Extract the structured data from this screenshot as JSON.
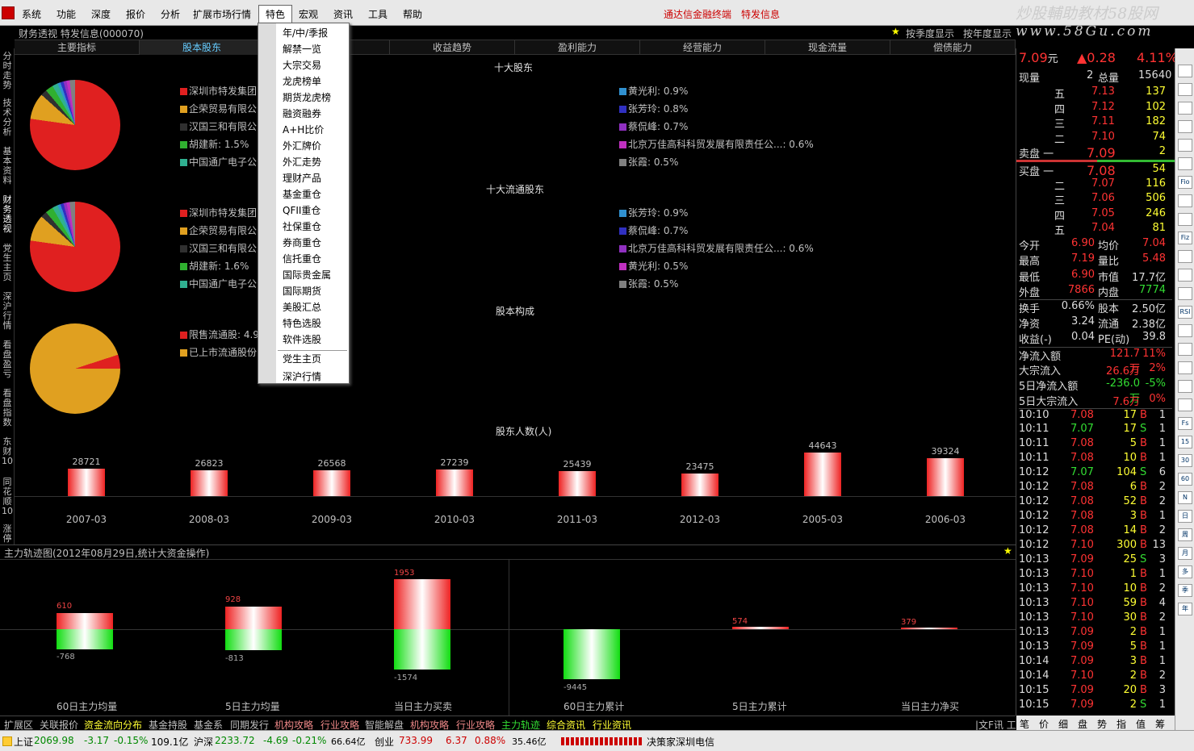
{
  "menu": {
    "items": [
      "系统",
      "功能",
      "深度",
      "报价",
      "分析",
      "扩展市场行情",
      "特色",
      "宏观",
      "资讯",
      "工具",
      "帮助"
    ],
    "right_links": [
      "通达信金融终端",
      "特发信息"
    ]
  },
  "watermark": {
    "line1": "炒股輔助教材58股网",
    "line2": "www.58Gu.com"
  },
  "header": {
    "title": "财务透视 特发信息(000070)",
    "right1": "按季度显示",
    "right2": "按年度显示"
  },
  "tabs": [
    "主要指标",
    "股本股东",
    "",
    "收益趋势",
    "盈利能力",
    "经营能力",
    "现金流量",
    "偿债能力"
  ],
  "left_tabs": [
    "分时走势",
    "技术分析",
    "基本资料",
    "财务透视",
    "党生主页",
    "深沪行情",
    "看盘盈亏",
    "看盘指数",
    "东财10",
    "同花顺10",
    "涨停"
  ],
  "sections": {
    "top10": "十大股东",
    "top10_float": "十大流通股东",
    "structure": "股本构成",
    "holders": "股东人数(人)"
  },
  "top10_left": [
    "深圳市特发集团",
    "企荣贸易有限公",
    "汉国三和有限公",
    "胡建新: 1.5%",
    "中国通广电子公"
  ],
  "top10_right": [
    "黄光利: 0.9%",
    "张芳玲: 0.8%",
    "蔡侃峰: 0.7%",
    "北京万佳高科科贸发展有限责任公...: 0.6%",
    "张霞: 0.5%"
  ],
  "float_left": [
    "深圳市特发集团",
    "企荣贸易有限公",
    "汉国三和有限公",
    "胡建新: 1.6%",
    "中国通广电子公"
  ],
  "float_right": [
    "张芳玲: 0.9%",
    "蔡侃峰: 0.7%",
    "北京万佳高科科贸发展有限责任公...: 0.6%",
    "黄光利: 0.5%",
    "张霞: 0.5%"
  ],
  "structure_legend": [
    "限售流通股: 4.9",
    "已上市流通股份"
  ],
  "colors": {
    "c1": "#e02020",
    "c2": "#e0a020",
    "c3": "#303030",
    "c4": "#30b030",
    "c5": "#30b090",
    "c6": "#3090d0",
    "c7": "#3030c0",
    "c8": "#9030c0",
    "c9": "#c030c0",
    "c10": "#808080"
  },
  "chart_data": {
    "type": "bar",
    "categories": [
      "2007-03",
      "2008-03",
      "2009-03",
      "2010-03",
      "2011-03",
      "2012-03",
      "2005-03",
      "2006-03"
    ],
    "values": [
      28721,
      26823,
      26568,
      27239,
      25439,
      23475,
      44643,
      39324
    ],
    "title": "股东人数(人)"
  },
  "main_force": {
    "title": "主力轨迹图(2012年08月29日,统计大资金操作)",
    "groups": [
      {
        "label": "60日主力均量",
        "pos": "610",
        "neg": "-768"
      },
      {
        "label": "5日主力均量",
        "pos": "928",
        "neg": "-813"
      },
      {
        "label": "当日主力买卖",
        "pos": "1953",
        "neg": "-1574"
      },
      {
        "label": "60日主力累计",
        "pos": "",
        "neg": "-9445"
      },
      {
        "label": "5日主力累计",
        "pos": "574",
        "neg": ""
      },
      {
        "label": "当日主力净买",
        "pos": "379",
        "neg": ""
      }
    ]
  },
  "bottom_tabs": [
    "扩展区",
    "关联报价",
    "资金流向分布",
    "基金持股",
    "基金系",
    "同期发行",
    "机构攻略",
    "行业攻略",
    "智能解盘",
    "机构攻略",
    "行业攻略",
    "主力轨迹",
    "综合资讯",
    "行业资讯"
  ],
  "bottom_right": "|文F讯 工|",
  "rp_tabs": [
    "笔",
    "价",
    "细",
    "盘",
    "势",
    "指",
    "值",
    "筹"
  ],
  "quote": {
    "price": "7.09",
    "unit": "元",
    "change": "▲0.28",
    "pct": "4.11%",
    "now_label": "现量",
    "now": "2",
    "total_label": "总量",
    "total": "15640",
    "asks": [
      [
        "五",
        "7.13",
        "137"
      ],
      [
        "四",
        "7.12",
        "102"
      ],
      [
        "三",
        "7.11",
        "182"
      ],
      [
        "二",
        "7.10",
        "74"
      ],
      [
        "卖盘 一",
        "7.09",
        "2"
      ]
    ],
    "bids": [
      [
        "买盘 一",
        "7.08",
        "54"
      ],
      [
        "二",
        "7.07",
        "116"
      ],
      [
        "三",
        "7.06",
        "506"
      ],
      [
        "四",
        "7.05",
        "246"
      ],
      [
        "五",
        "7.04",
        "81"
      ]
    ],
    "stats": [
      [
        "今开",
        "6.90",
        "均价",
        "7.04"
      ],
      [
        "最高",
        "7.19",
        "量比",
        "5.48"
      ],
      [
        "最低",
        "6.90",
        "市值",
        "17.7亿"
      ],
      [
        "外盘",
        "7866",
        "内盘",
        "7774"
      ],
      [
        "换手",
        "0.66%",
        "股本",
        "2.50亿"
      ],
      [
        "净资",
        "3.24",
        "流通",
        "2.38亿"
      ],
      [
        "收益(-)",
        "0.04",
        "PE(动)",
        "39.8"
      ]
    ],
    "flows": [
      [
        "净流入额",
        "121.7万",
        "11%"
      ],
      [
        "大宗流入",
        "26.6万",
        "2%"
      ],
      [
        "5日净流入额",
        "-236.0万",
        "-5%"
      ],
      [
        "5日大宗流入",
        "7.6万",
        "0%"
      ]
    ],
    "ticks": [
      [
        "10:10",
        "7.08",
        "17",
        "B",
        "1"
      ],
      [
        "10:11",
        "7.07",
        "17",
        "S",
        "1"
      ],
      [
        "10:11",
        "7.08",
        "5",
        "B",
        "1"
      ],
      [
        "10:11",
        "7.08",
        "10",
        "B",
        "1"
      ],
      [
        "10:12",
        "7.07",
        "104",
        "S",
        "6"
      ],
      [
        "10:12",
        "7.08",
        "6",
        "B",
        "2"
      ],
      [
        "10:12",
        "7.08",
        "52",
        "B",
        "2"
      ],
      [
        "10:12",
        "7.08",
        "3",
        "B",
        "1"
      ],
      [
        "10:12",
        "7.08",
        "14",
        "B",
        "2"
      ],
      [
        "10:12",
        "7.10",
        "300",
        "B",
        "13"
      ],
      [
        "10:13",
        "7.09",
        "25",
        "S",
        "3"
      ],
      [
        "10:13",
        "7.10",
        "1",
        "B",
        "1"
      ],
      [
        "10:13",
        "7.10",
        "10",
        "B",
        "2"
      ],
      [
        "10:13",
        "7.10",
        "59",
        "B",
        "4"
      ],
      [
        "10:13",
        "7.10",
        "30",
        "B",
        "2"
      ],
      [
        "10:13",
        "7.09",
        "2",
        "B",
        "1"
      ],
      [
        "10:13",
        "7.09",
        "5",
        "B",
        "1"
      ],
      [
        "10:14",
        "7.09",
        "3",
        "B",
        "1"
      ],
      [
        "10:14",
        "7.10",
        "2",
        "B",
        "2"
      ],
      [
        "10:15",
        "7.09",
        "20",
        "B",
        "3"
      ],
      [
        "10:15",
        "7.09",
        "2",
        "S",
        "1"
      ]
    ]
  },
  "iconbar": [
    "",
    "",
    "",
    "",
    "",
    "",
    "Fio",
    "",
    "",
    "Fiz",
    "",
    "",
    "",
    "RSI",
    "",
    "",
    "",
    "",
    "",
    "Fs",
    "15",
    "30",
    "60",
    "N",
    "日",
    "周",
    "月",
    "多",
    "季",
    "年"
  ],
  "dropdown": [
    "年/中/季报",
    "解禁一览",
    "大宗交易",
    "龙虎榜单",
    "期货龙虎榜",
    "融资融券",
    "A+H比价",
    "外汇牌价",
    "外汇走势",
    "理财产品",
    "基金重仓",
    "QFII重仓",
    "社保重仓",
    "券商重仓",
    "信托重仓",
    "国际贵金属",
    "国际期货",
    "美股汇总",
    "特色选股",
    "软件选股",
    "党生主页",
    "深沪行情"
  ],
  "status": {
    "sh_label": "上证",
    "sh": "2069.98",
    "sh_chg": "-3.17",
    "sh_pct": "-0.15%",
    "sh_amt": "109.1亿",
    "sz_label": "沪深",
    "sz": "2233.72",
    "sz_chg": "-4.69",
    "sz_pct": "-0.21%",
    "sz_amt": "66.64亿",
    "cy_label": "创业",
    "cy": "733.99",
    "cy_chg": "6.37",
    "cy_pct": "0.88%",
    "cy_amt": "35.46亿",
    "right": "决策家深圳电信"
  }
}
